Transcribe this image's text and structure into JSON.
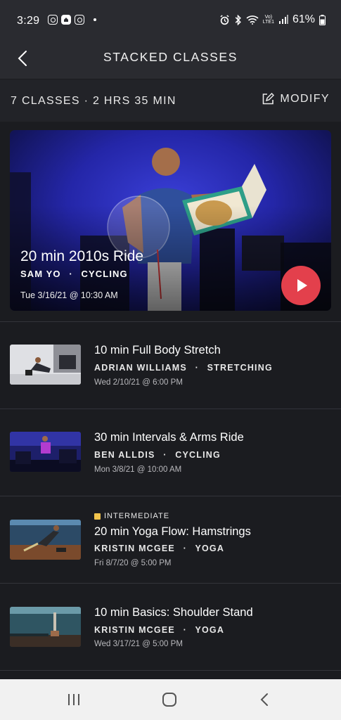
{
  "status_bar": {
    "time": "3:29",
    "battery": "61%",
    "network": "Vo) LTE1"
  },
  "header": {
    "title": "STACKED CLASSES"
  },
  "summary": {
    "text": "7 CLASSES · 2 HRS 35 MIN",
    "modify_label": "MODIFY"
  },
  "featured": {
    "title": "20 min 2010s Ride",
    "instructor": "SAM YO",
    "separator": "·",
    "category": "CYCLING",
    "date": "Tue 3/16/21 @ 10:30 AM"
  },
  "classes": [
    {
      "title": "10 min Full Body Stretch",
      "instructor": "ADRIAN WILLIAMS",
      "category": "STRETCHING",
      "date": "Wed 2/10/21 @ 6:00 PM",
      "level": ""
    },
    {
      "title": "30 min Intervals & Arms Ride",
      "instructor": "BEN ALLDIS",
      "category": "CYCLING",
      "date": "Mon 3/8/21 @ 10:00 AM",
      "level": ""
    },
    {
      "title": "20 min Yoga Flow: Hamstrings",
      "instructor": "KRISTIN MCGEE",
      "category": "YOGA",
      "date": "Fri 8/7/20 @ 5:00 PM",
      "level": "INTERMEDIATE"
    },
    {
      "title": "10 min Basics: Shoulder Stand",
      "instructor": "KRISTIN MCGEE",
      "category": "YOGA",
      "date": "Wed 3/17/21 @ 5:00 PM",
      "level": ""
    }
  ],
  "colors": {
    "background": "#1b1c20",
    "header": "#2a2b30",
    "accent_play": "#e3404c",
    "level_intermediate": "#f2c44c"
  },
  "icons": [
    "back-arrow-icon",
    "edit-icon",
    "play-icon",
    "recent-apps-icon",
    "home-icon",
    "nav-back-icon"
  ]
}
